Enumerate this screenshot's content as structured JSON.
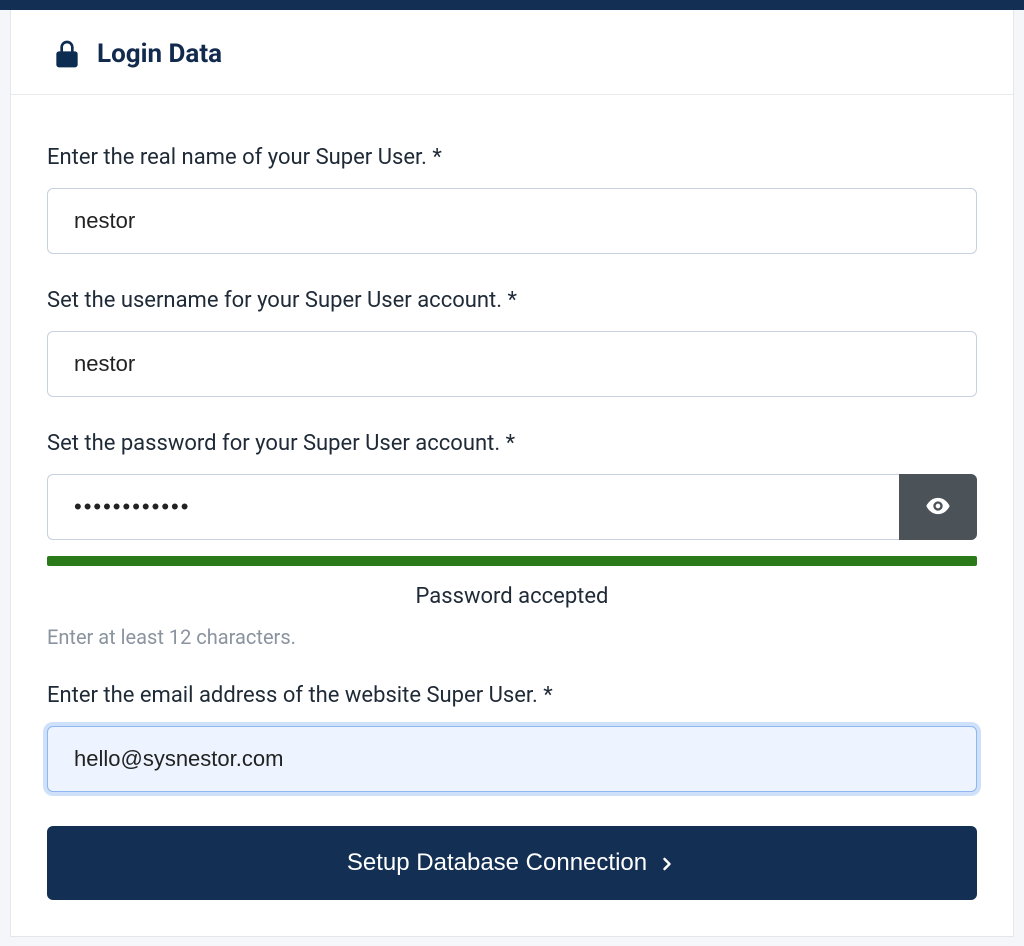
{
  "section": {
    "title": "Login Data"
  },
  "fields": {
    "realname": {
      "label": "Enter the real name of your Super User. *",
      "value": "nestor"
    },
    "username": {
      "label": "Set the username for your Super User account. *",
      "value": "nestor"
    },
    "password": {
      "label": "Set the password for your Super User account. *",
      "value": "••••••••••••",
      "status": "Password accepted",
      "hint": "Enter at least 12 characters."
    },
    "email": {
      "label": "Enter the email address of the website Super User. *",
      "value": "hello@sysnestor.com"
    }
  },
  "button": {
    "submit": "Setup Database Connection"
  }
}
